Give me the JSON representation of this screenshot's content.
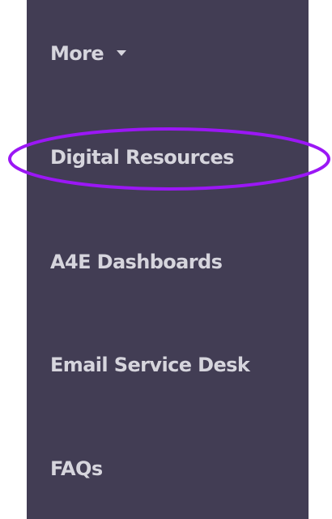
{
  "menu": {
    "more_label": "More",
    "items": [
      {
        "label": "Digital Resources"
      },
      {
        "label": "A4E Dashboards"
      },
      {
        "label": "Email Service Desk"
      },
      {
        "label": "FAQs"
      }
    ]
  },
  "colors": {
    "menu_background": "#423d54",
    "menu_text": "#d6d5dd",
    "highlight_ring": "#9b17f5"
  },
  "icons": {
    "more_caret": "caret-down-icon"
  },
  "annotation": {
    "highlighted_item": "Digital Resources"
  }
}
